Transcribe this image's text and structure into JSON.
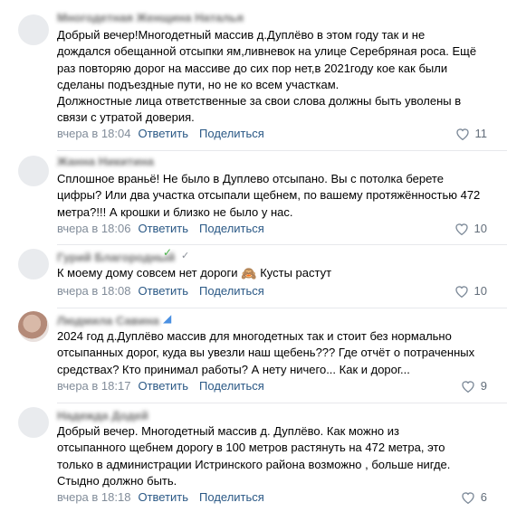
{
  "comments": [
    {
      "name": "Многодетная Женщина Наталья",
      "text": "Добрый вечер!Многодетный массив д.Дуплёво в этом году так и не\nдождался обещанной отсыпки ям,ливневок на улице Серебряная роса. Ещё\nраз повторяю дорог на массиве до сих пор нет,в 2021году кое как были\nсделаны подъездные пути, но не ко всем участкам.\nДолжностные лица ответственные за свои слова должны быть уволены в\nсвязи с утратой доверия.",
      "time": "вчера в 18:04",
      "reply": "Ответить",
      "share": "Поделиться",
      "likes": "11"
    },
    {
      "name": "Жанна Никитина",
      "text": "Сплошное враньё! Не было в Дуплево отсыпано. Вы с потолка берете\nцифры? Или два участка отсыпали щебнем, по вашему протяжённостью 472\nметра?!!! А крошки и близко не было у нас.",
      "time": "вчера в 18:06",
      "reply": "Ответить",
      "share": "Поделиться",
      "likes": "10"
    },
    {
      "name": "Гурий Благородный",
      "text_before": "К моему дому совсем нет дороги ",
      "emoji": "🙈",
      "text_after": " Кусты растут",
      "time": "вчера в 18:08",
      "reply": "Ответить",
      "share": "Поделиться",
      "likes": "10"
    },
    {
      "name": "Людмила Савина",
      "text": "2024 год д.Дуплёво массив для многодетных так и стоит без нормально\nотсыпанных дорог, куда вы увезли наш щебень??? Где отчёт о потраченных\nсредствах? Кто принимал работы? А нету ничего... Как и дорог...",
      "time": "вчера в 18:17",
      "reply": "Ответить",
      "share": "Поделиться",
      "likes": "9"
    },
    {
      "name": "Надежда Додей",
      "text": "Добрый вечер. Многодетный массив д. Дуплёво. Как можно из\nотсыпанного щебнем дорогу в 100 метров растянуть на 472 метра, это\nтолько в администрации Истринского района возможно , больше нигде.\nСтыдно должно быть.",
      "time": "вчера в 18:18",
      "reply": "Ответить",
      "share": "Поделиться",
      "likes": "6"
    }
  ]
}
